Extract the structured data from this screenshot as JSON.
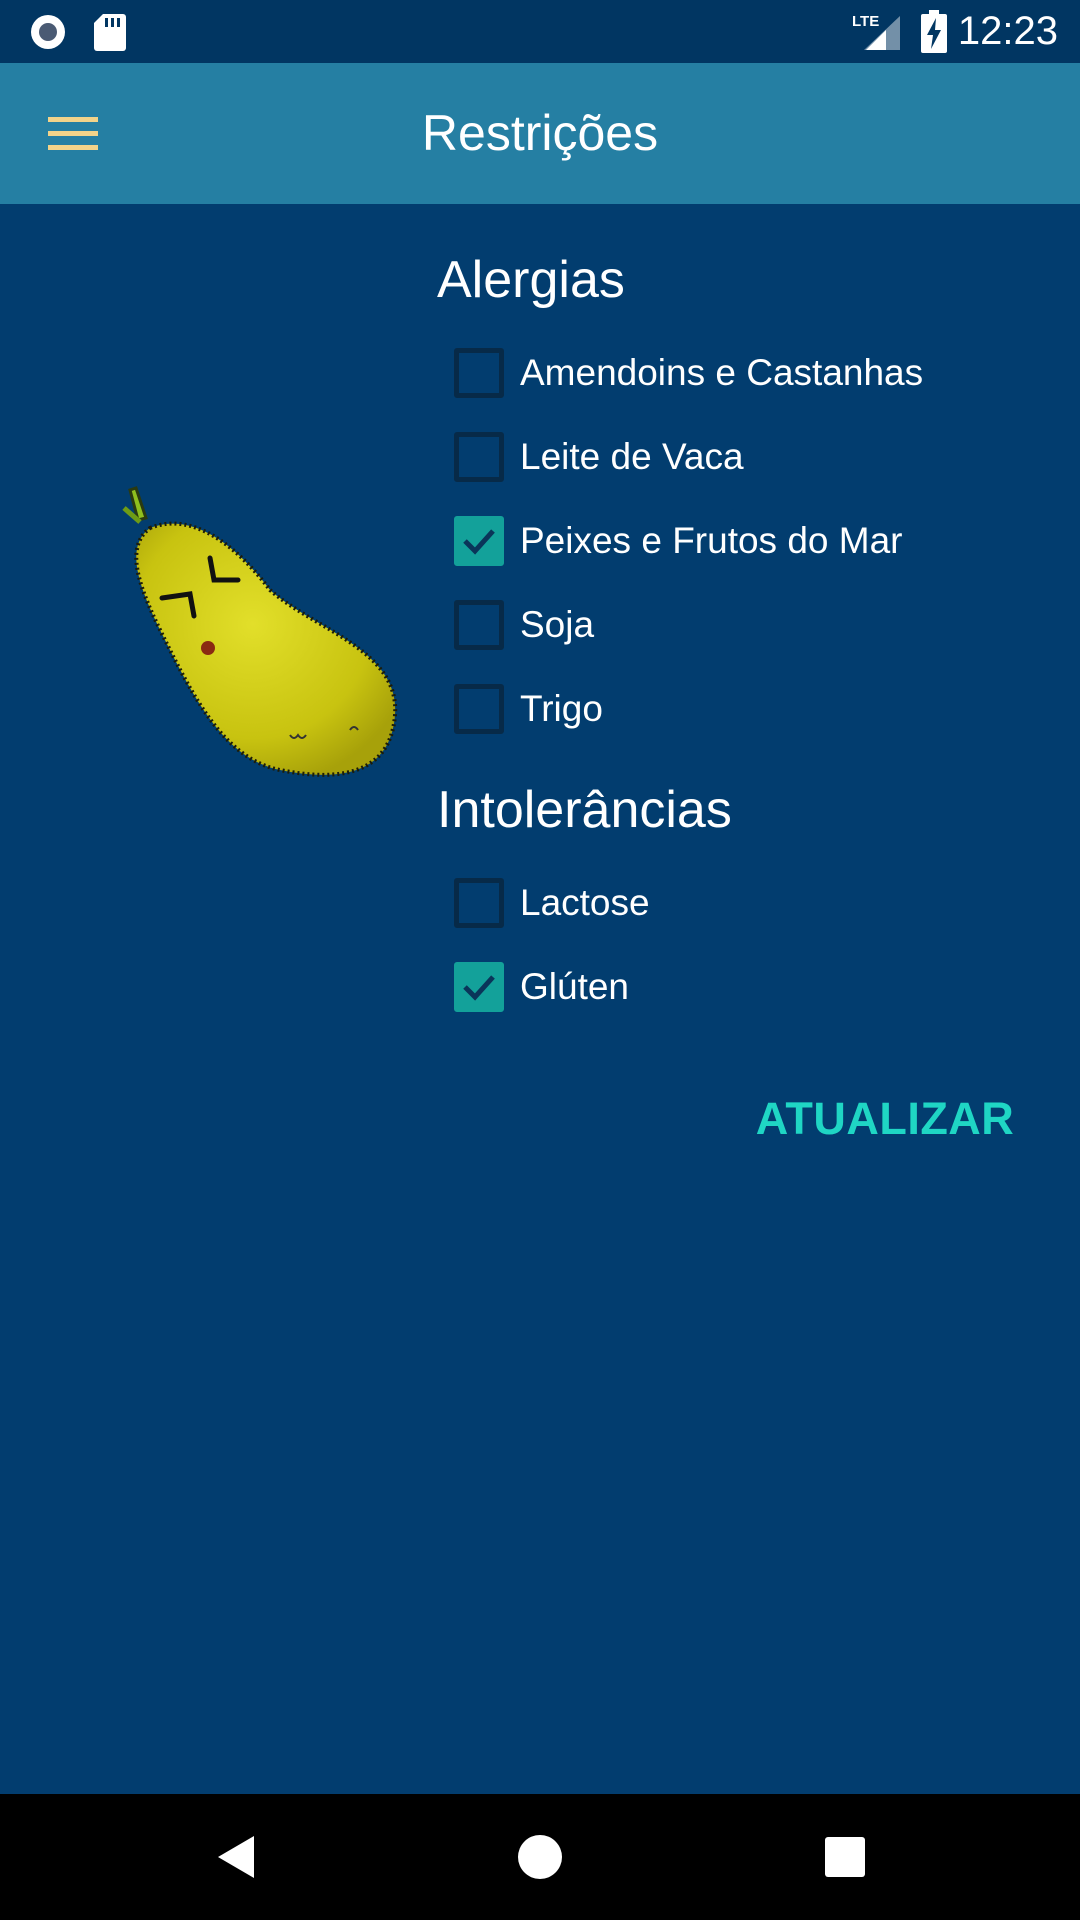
{
  "status_bar": {
    "time": "12:23",
    "network": "LTE",
    "icons": [
      "record-icon",
      "sd-card-icon",
      "lte-signal-icon",
      "battery-charging-icon"
    ]
  },
  "app_bar": {
    "title": "Restrições",
    "menu_icon": "hamburger-menu-icon"
  },
  "mascot": {
    "description_icon": "mascot-fruit-illustration"
  },
  "allergies": {
    "heading": "Alergias",
    "items": [
      {
        "label": "Amendoins e Castanhas",
        "checked": false
      },
      {
        "label": "Leite de Vaca",
        "checked": false
      },
      {
        "label": "Peixes e Frutos do Mar",
        "checked": true
      },
      {
        "label": "Soja",
        "checked": false
      },
      {
        "label": "Trigo",
        "checked": false
      }
    ]
  },
  "intolerances": {
    "heading": "Intolerâncias",
    "items": [
      {
        "label": "Lactose",
        "checked": false
      },
      {
        "label": "Glúten",
        "checked": true
      }
    ]
  },
  "actions": {
    "update_label": "ATUALIZAR"
  },
  "colors": {
    "background": "#023d6f",
    "app_bar": "#257fa3",
    "status_bar": "#013662",
    "checkbox_checked": "#13a19a",
    "accent_button": "#1fd6c4",
    "menu_icon": "#f2d38a"
  },
  "nav_bar": {
    "buttons": [
      "back-icon",
      "home-icon",
      "recents-icon"
    ]
  }
}
